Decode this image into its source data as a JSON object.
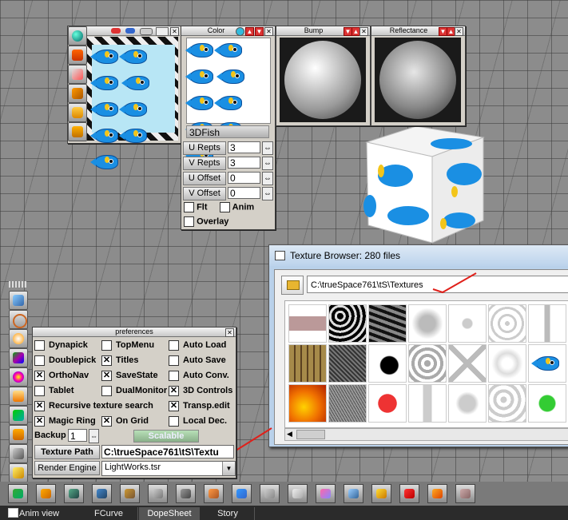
{
  "color_panel": {
    "title": "Color",
    "texture_name": "3DFish",
    "fields": [
      {
        "label": "U Repts",
        "value": "3"
      },
      {
        "label": "V Repts",
        "value": "3"
      },
      {
        "label": "U Offset",
        "value": "0"
      },
      {
        "label": "V Offset",
        "value": "0"
      }
    ],
    "flt_label": "Flt",
    "anim_label": "Anim",
    "overlay_label": "Overlay"
  },
  "bump_panel": {
    "title": "Bump"
  },
  "reflectance_panel": {
    "title": "Reflectance"
  },
  "texture_browser": {
    "title": "Texture Browser: 280 files",
    "path": "C:\\trueSpace761\\tS\\Textures"
  },
  "preferences": {
    "title": "preferences",
    "items": [
      {
        "label": "Dynapick",
        "checked": false
      },
      {
        "label": "TopMenu",
        "checked": false
      },
      {
        "label": "Auto Load",
        "checked": false
      },
      {
        "label": "Doublepick",
        "checked": false
      },
      {
        "label": "Titles",
        "checked": true
      },
      {
        "label": "Auto Save",
        "checked": false
      },
      {
        "label": "OrthoNav",
        "checked": true
      },
      {
        "label": "SaveState",
        "checked": true
      },
      {
        "label": "Auto Conv.",
        "checked": false
      },
      {
        "label": "Tablet",
        "checked": false
      },
      {
        "label": "DualMonitor",
        "checked": false
      },
      {
        "label": "3D Controls",
        "checked": true
      },
      {
        "label": "Recursive texture search",
        "checked": true
      },
      {
        "label": "Transp.edit",
        "checked": true
      },
      {
        "label": "Magic Ring",
        "checked": true
      },
      {
        "label": "On Grid",
        "checked": true
      },
      {
        "label": "Local Dec.",
        "checked": false
      }
    ],
    "backup_label": "Backup",
    "backup_value": "1",
    "scalable_label": "Scalable",
    "texture_path_label": "Texture Path",
    "texture_path_value": "C:\\trueSpace761\\tS\\Textu",
    "render_engine_label": "Render Engine",
    "render_engine_value": "LightWorks.tsr"
  },
  "bottom_tabs": {
    "anim_view": "Anim view",
    "fcurve": "FCurve",
    "dopesheet": "DopeSheet",
    "story": "Story"
  },
  "colors": {
    "accent_annotation": "#e0201a",
    "fish_blue": "#1a8fe3",
    "panel_bg": "#d4d0c8"
  }
}
